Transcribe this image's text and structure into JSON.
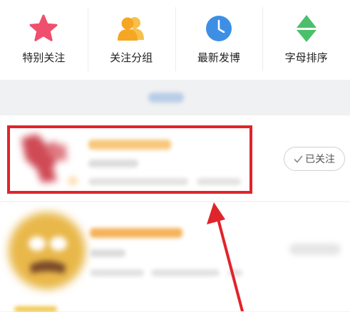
{
  "tabs": [
    {
      "label": "特别关注",
      "icon": "star-icon",
      "color": "#ef4f6d"
    },
    {
      "label": "关注分组",
      "icon": "people-group-icon",
      "color": "#f5b62c"
    },
    {
      "label": "最新发博",
      "icon": "clock-icon",
      "color": "#3d8fe5"
    },
    {
      "label": "字母排序",
      "icon": "diamond-sort-icon",
      "color": "#4cbf6b"
    }
  ],
  "rows": [
    {
      "follow_label": "已关注"
    }
  ],
  "colors": {
    "highlight": "#e0242b",
    "accent_orange": "#f5a623"
  }
}
